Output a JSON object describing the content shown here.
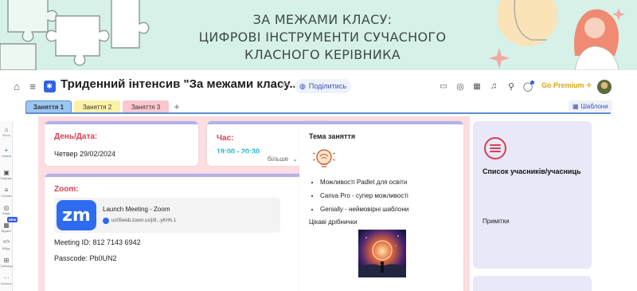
{
  "banner": {
    "line1": "ЗА МЕЖАМИ КЛАСУ:",
    "line2": "ЦИФРОВІ ІНСТРУМЕНТИ СУЧАСНОГО",
    "line3": "КЛАСНОГО КЕРІВНИКА"
  },
  "toolbar": {
    "title": "Триденний інтенсив \"За межами класу...\"",
    "share_label": "Поділитись",
    "go_premium": "Go Premium ✧"
  },
  "tabs": [
    {
      "label": "Заняття 1"
    },
    {
      "label": "Заняття 2"
    },
    {
      "label": "Заняття 3"
    },
    {
      "label": "+"
    }
  ],
  "templates_label": "Шаблони",
  "leftbar": {
    "items": [
      {
        "icon": "⌂",
        "label": "Блок"
      },
      {
        "icon": "+",
        "label": "Новий"
      },
      {
        "icon": "▣",
        "label": "Зображ."
      },
      {
        "icon": "≡",
        "label": "Списки"
      },
      {
        "icon": "◎",
        "label": "Завд."
      },
      {
        "icon": "▦",
        "label": "Віджет"
      },
      {
        "icon": "</>",
        "label": "Вбуд."
      },
      {
        "icon": "⊞",
        "label": "Таблиця"
      },
      {
        "icon": "···",
        "label": "Більше"
      }
    ],
    "new_badge": "NEW"
  },
  "cards": {
    "date": {
      "title": "День/Дата:",
      "value": "Четвер 29/02/2024"
    },
    "time": {
      "title": "Час:",
      "value": "19:00 - 20:30",
      "more": "більше"
    },
    "zoom": {
      "title": "Zoom:",
      "logo": "zm",
      "link_title": "Launch Meeting - Zoom",
      "link_url": "us05web.zoom.us/j/8...yKHh.1",
      "meeting_id": "Meeting ID: 812 7143 6942",
      "passcode": "Passcode: Pb0UN2"
    },
    "topic": {
      "title": "Тема заняття",
      "bullets": [
        "Можливості Padlet для освіти",
        "Canva Pro - супер можливості",
        "Genially - неймовірні шаблони"
      ],
      "extra": "Цікаві дрібнички"
    },
    "participants": {
      "title": "Список учасників/учасниць",
      "notes": "Примітки"
    }
  },
  "colors": {
    "accent_red": "#d93f4f",
    "card_bar": "#b5b0ea",
    "canvas_bg": "#fbdde2",
    "time_blue": "#1fb3c9",
    "premium_gold": "#d8a514"
  }
}
